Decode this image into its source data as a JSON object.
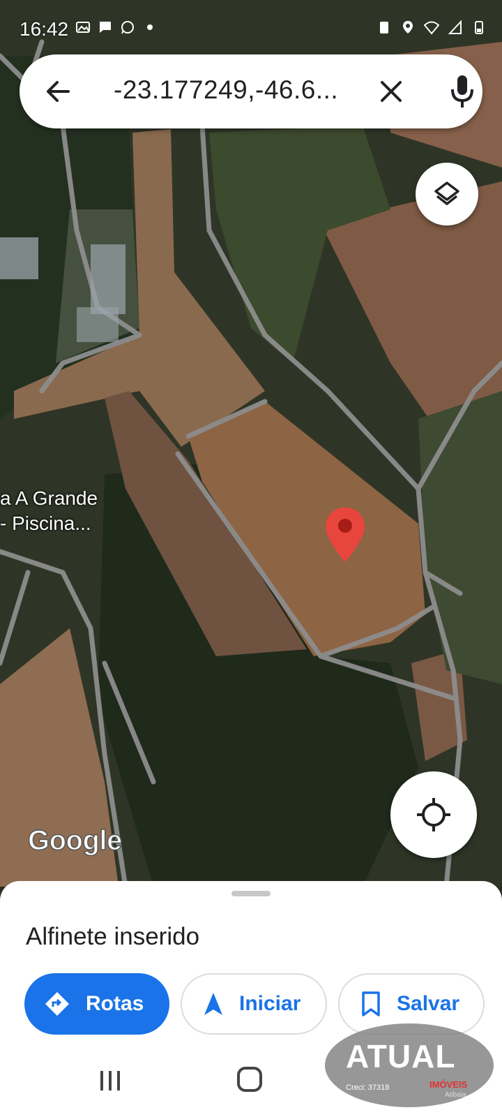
{
  "status_bar": {
    "time": "16:42",
    "left_icons": [
      "gallery-icon",
      "message-icon",
      "whatsapp-icon",
      "dot-icon"
    ],
    "right_icons": [
      "battery-saver-icon",
      "location-icon",
      "wifi-icon",
      "signal-icon",
      "battery-icon"
    ]
  },
  "search": {
    "query": "-23.177249,-46.6...",
    "back_icon": "arrow-back-icon",
    "clear_icon": "close-icon",
    "mic_icon": "mic-icon"
  },
  "map": {
    "type": "satellite",
    "place_label_line1": "a A Grande",
    "place_label_line2": "- Piscina...",
    "pin_color": "#e8453c",
    "attribution": "Google"
  },
  "controls": {
    "layers_icon": "layers-icon",
    "locate_icon": "my-location-icon"
  },
  "sheet": {
    "title": "Alfinete inserido",
    "actions": [
      {
        "label": "Rotas",
        "icon": "directions-icon",
        "style": "primary"
      },
      {
        "label": "Iniciar",
        "icon": "navigation-arrow-icon",
        "style": "outline"
      },
      {
        "label": "Salvar",
        "icon": "bookmark-icon",
        "style": "outline"
      }
    ]
  },
  "nav_bar": {
    "icons": [
      "recents-icon",
      "home-icon",
      "back-icon"
    ]
  },
  "watermark": {
    "text": "ATUAL",
    "sub": "IMÓVEIS",
    "creci": "Creci: 37318",
    "city": "Atibaia"
  },
  "colors": {
    "accent": "#1a73e8",
    "sheet_bg": "#ffffff",
    "text": "#202124"
  }
}
